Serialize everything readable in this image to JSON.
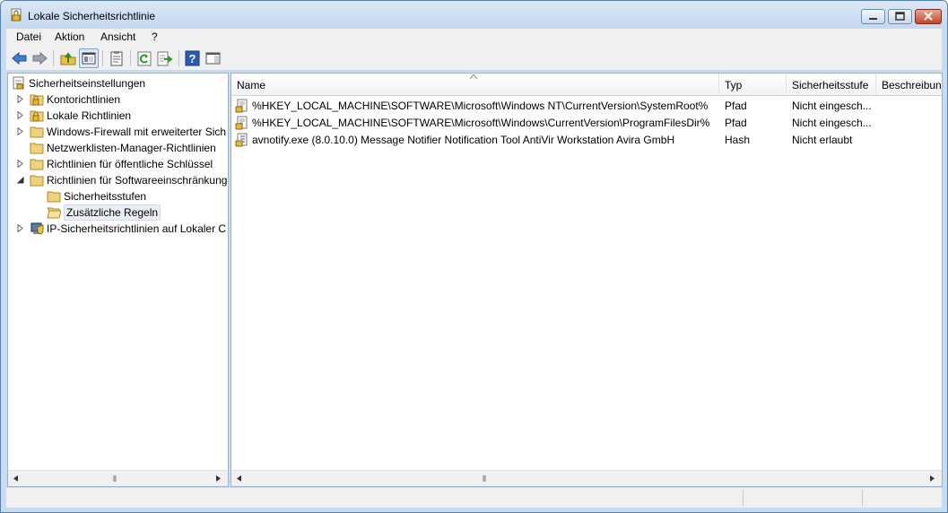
{
  "window": {
    "title": "Lokale Sicherheitsrichtlinie"
  },
  "menu": [
    {
      "label": "Datei"
    },
    {
      "label": "Aktion"
    },
    {
      "label": "Ansicht"
    },
    {
      "label": "?"
    }
  ],
  "toolbar": {
    "items": [
      {
        "name": "back-icon"
      },
      {
        "name": "forward-icon"
      },
      {
        "name": "up-folder-icon"
      },
      {
        "name": "show-hide-tree-icon",
        "pressed": true
      },
      {
        "name": "properties-icon"
      },
      {
        "name": "refresh-icon"
      },
      {
        "name": "export-list-icon"
      },
      {
        "name": "help-icon"
      },
      {
        "name": "action-pane-icon"
      }
    ]
  },
  "tree": {
    "root": "Sicherheitseinstellungen",
    "items": [
      {
        "label": "Kontorichtlinien",
        "expandable": true,
        "icon": "policy-folder-icon"
      },
      {
        "label": "Lokale Richtlinien",
        "expandable": true,
        "icon": "policy-folder-icon"
      },
      {
        "label": "Windows-Firewall mit erweiterter Sich",
        "expandable": true,
        "icon": "folder-icon"
      },
      {
        "label": "Netzwerklisten-Manager-Richtlinien",
        "expandable": false,
        "icon": "folder-icon"
      },
      {
        "label": "Richtlinien für öffentliche Schlüssel",
        "expandable": true,
        "icon": "folder-icon"
      },
      {
        "label": "Richtlinien für Softwareeinschränkung",
        "expandable": true,
        "expanded": true,
        "icon": "folder-icon"
      },
      {
        "label": "Sicherheitsstufen",
        "child": true,
        "icon": "folder-icon"
      },
      {
        "label": "Zusätzliche Regeln",
        "child": true,
        "selected": true,
        "icon": "folder-open-icon"
      },
      {
        "label": "IP-Sicherheitsrichtlinien auf Lokaler C",
        "expandable": true,
        "icon": "ip-security-icon"
      }
    ]
  },
  "list": {
    "columns": [
      "Name",
      "Typ",
      "Sicherheitsstufe",
      "Beschreibun"
    ],
    "rows": [
      {
        "name": "%HKEY_LOCAL_MACHINE\\SOFTWARE\\Microsoft\\Windows NT\\CurrentVersion\\SystemRoot%",
        "type": "Pfad",
        "level": "Nicht eingesch...",
        "icon": "path-rule-icon"
      },
      {
        "name": "%HKEY_LOCAL_MACHINE\\SOFTWARE\\Microsoft\\Windows\\CurrentVersion\\ProgramFilesDir%",
        "type": "Pfad",
        "level": "Nicht eingesch...",
        "icon": "path-rule-icon"
      },
      {
        "name": "avnotify.exe (8.0.10.0)  Message Notifier  Notification Tool  AntiVir Workstation  Avira GmbH",
        "type": "Hash",
        "level": "Nicht erlaubt",
        "icon": "hash-rule-icon"
      }
    ]
  },
  "colors": {
    "title_bg": "#c5d8ee",
    "selection": "#e9eef5",
    "border": "#9fb4cb"
  }
}
